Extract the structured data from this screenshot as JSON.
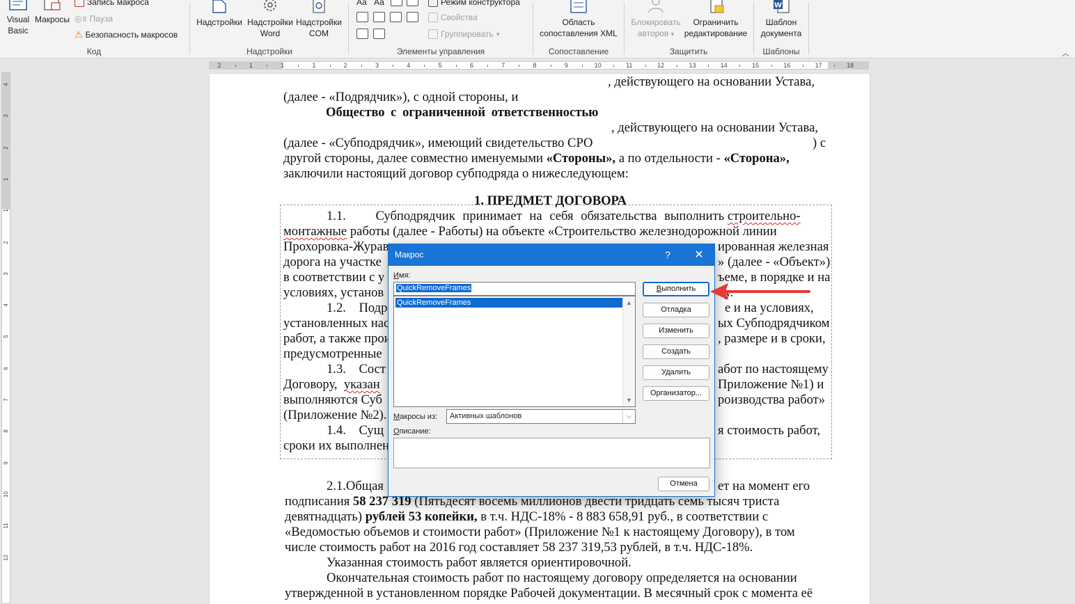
{
  "ribbon": {
    "code": {
      "visual_basic": [
        "Visual",
        "Basic"
      ],
      "macros": "Макросы",
      "record_macro": "Запись макроса",
      "pause": "Пауза",
      "macro_security": "Безопасность макросов",
      "group": "Код"
    },
    "addins": {
      "addins": "Надстройки",
      "word_addins": [
        "Надстройки",
        "Word"
      ],
      "com_addins": [
        "Надстройки",
        "COM"
      ],
      "group": "Надстройки"
    },
    "controls": {
      "aa1": "Аа",
      "aa2": "Аа",
      "design_mode": "Режим конструктора",
      "properties": "Свойства",
      "group_btn": "Группировать",
      "group": "Элементы управления"
    },
    "mapping": {
      "xml_pane": [
        "Область",
        "сопоставления XML"
      ],
      "group": "Сопоставление"
    },
    "protect": {
      "block_authors": [
        "Блокировать",
        "авторов"
      ],
      "restrict_editing": [
        "Ограничить",
        "редактирование"
      ],
      "group": "Защитить"
    },
    "templates": {
      "doc_template": [
        "Шаблон",
        "документа"
      ],
      "group": "Шаблоны"
    }
  },
  "ruler": {
    "corner": "L",
    "h_labels": [
      "2",
      "1",
      "1",
      "1",
      "2",
      "3",
      "4",
      "5",
      "6",
      "7",
      "8",
      "9",
      "10",
      "11",
      "12",
      "13",
      "14",
      "15",
      "16",
      "17",
      "18"
    ],
    "v_labels": [
      "4",
      "3",
      "2",
      "1",
      "1",
      "2",
      "3",
      "4",
      "5",
      "6",
      "7",
      "8",
      "9",
      "10",
      "11",
      "12"
    ]
  },
  "document": {
    "lines": [
      ", действующего на основании Устава,",
      "(далее - «Подрядчик»), с одной стороны, и",
      "Общество с ограниченной ответственностью",
      ", действующего на основании Устава,",
      "(далее - «Субподрядчик», имеющий свидетельство СРО",
      ") с",
      "другой стороны, далее совместно именуемыми",
      "«Стороны»,",
      "а по отдельности -",
      "«Сторона»,",
      "заключили настоящий договор субподряда о нижеследующем:",
      "1. ПРЕДМЕТ ДОГОВОРА",
      "1.1.    Субподрядчик принимает на себя обязательства выполнить",
      "строительно-",
      "монтажные",
      "работы (далее - Работы) на объекте «Строительство железнодорожной линии",
      "Прохоровка-Журав",
      "ированная железная",
      "дорога на участке",
      "» (далее - «Объект»)",
      "в соответствии с у",
      "ъеме, в порядке и на",
      "условиях, установ",
      "у.",
      "1.2.    Подр",
      "е и на условиях,",
      "установленных нас",
      "ых Субподрядчиком",
      "работ, а также прои",
      ", размере и в сроки,",
      "предусмотренные",
      "1.3.    Сост",
      "абот по настоящему",
      "Договору,",
      "указан",
      "Приложение №1) и",
      "выполняются Суб",
      "роизводства работ»",
      "(Приложение №2).",
      "1.4.    Сущ",
      "я стоимость работ,",
      "сроки их выполнен",
      "2.1.Общая",
      "ет на момент его",
      "подписания",
      "58 237 319",
      "(Пятьдесят восемь миллионов двести тридцать семь тысяч триста",
      "девятнадцать)",
      "рублей 53 копейки,",
      "в т.ч. НДС-18% - 8 883 658,91 руб., в соответствии с",
      "«Ведомостью объемов и стоимости работ» (Приложение №1 к настоящему Договору), в том",
      "числе стоимость работ на 2016 год составляет 58 237 319,53 рублей, в т.ч. НДС-18%.",
      "Указанная стоимость работ является ориентировочной.",
      "Окончательная стоимость работ по настоящему договору определяется на основании",
      "утвержденной в установленном порядке Рабочей документации. В месячный срок с момента её"
    ]
  },
  "dialog": {
    "title": "Макрос",
    "help": "?",
    "close": "✕",
    "name_label": "Имя:",
    "name_value": "QuickRemoveFrames",
    "list_items": [
      "QuickRemoveFrames"
    ],
    "macros_from_label": "Макросы из:",
    "macros_from_value": "Активных шаблонов",
    "description_label": "Описание:",
    "buttons": {
      "run": "Выполнить",
      "debug": "Отладка",
      "edit": "Изменить",
      "create": "Создать",
      "delete": "Удалить",
      "organizer": "Организатор...",
      "cancel": "Отмена"
    }
  },
  "colors": {
    "accent": "#1874d6",
    "selection": "#0f6bd0",
    "arrow": "#e53935"
  }
}
